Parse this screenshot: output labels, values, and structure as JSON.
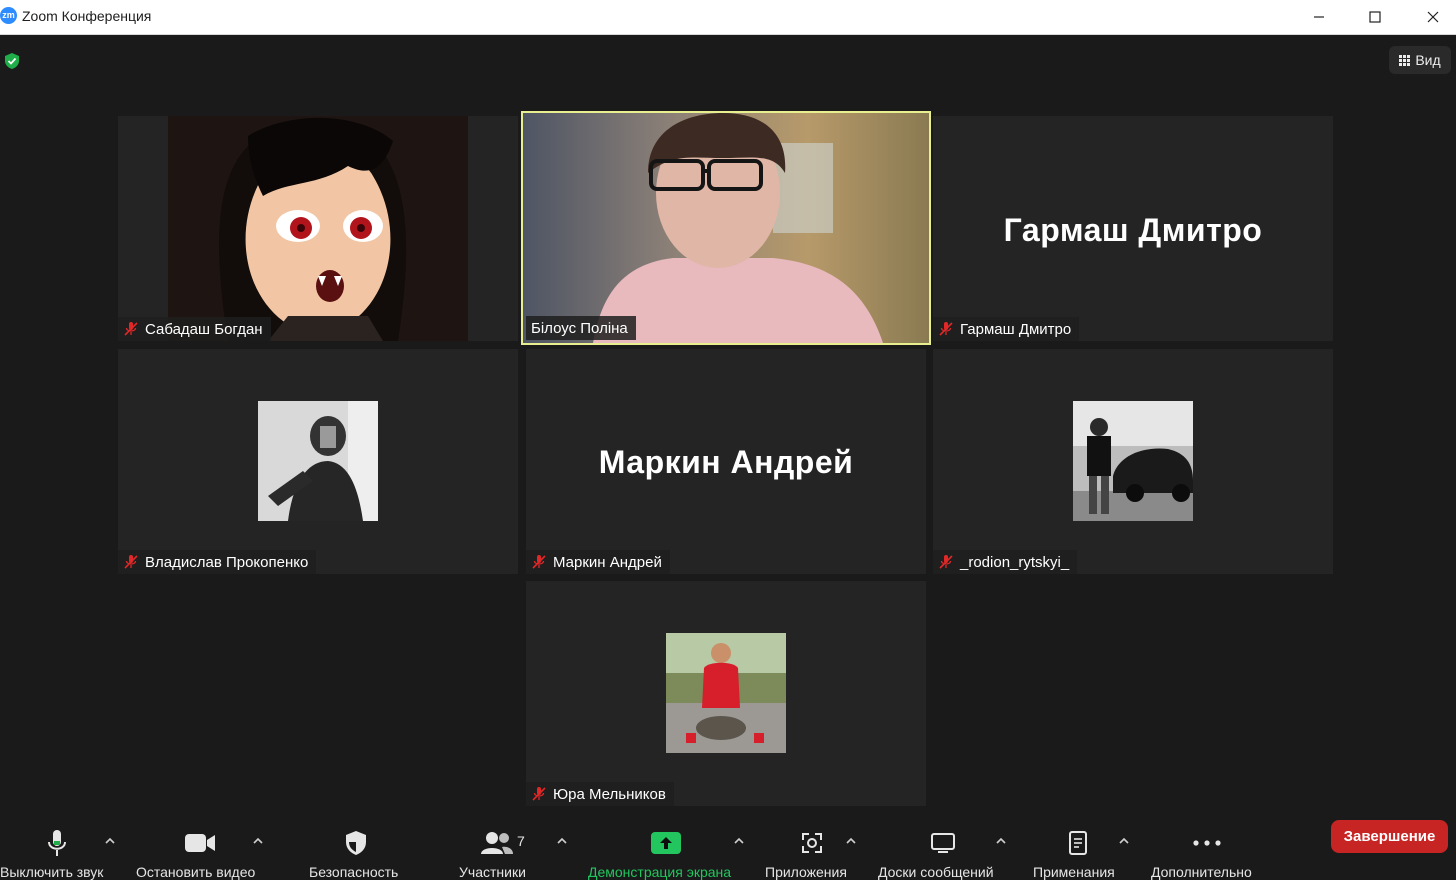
{
  "window": {
    "title": "Zoom Конференция",
    "app_icon_text": "zm",
    "controls": [
      "minimize-icon",
      "maximize-icon",
      "close-icon"
    ]
  },
  "top": {
    "security_badge_icon": "shield-check-icon",
    "view_label": "Вид",
    "view_icon": "grid-icon"
  },
  "tiles": [
    {
      "name": "Сабадаш Богдан",
      "muted": true,
      "video": "anime-picture",
      "active": false
    },
    {
      "name": "Білоус Поліна",
      "muted": false,
      "video": "camera",
      "active": true
    },
    {
      "name": "Гармаш Дмитро",
      "muted": true,
      "big_name": "Гармаш Дмитро",
      "active": false
    },
    {
      "name": "Владислав Прокопенко",
      "muted": true,
      "video": "avatar-photo",
      "active": false
    },
    {
      "name": "Маркин Андрей",
      "muted": true,
      "big_name": "Маркин Андрей",
      "active": false
    },
    {
      "name": "_rodion_rytskyi_",
      "muted": true,
      "video": "avatar-photo",
      "active": false
    },
    {
      "name": "Юра Мельников",
      "muted": true,
      "video": "avatar-photo",
      "active": false
    }
  ],
  "toolbar": {
    "mute_label": "Выключить звук",
    "video_label": "Остановить видео",
    "security_label": "Безопасность",
    "participants_label": "Участники",
    "participants_count": "7",
    "share_label": "Демонстрация экрана",
    "apps_label": "Приложения",
    "whiteboards_label": "Доски сообщений",
    "notes_label": "Применания",
    "more_label": "Дополнительно",
    "end_label": "Завершение"
  },
  "colors": {
    "active_speaker": "#e8ef8e",
    "share_green": "#22c55e",
    "end_red": "#c72424",
    "muted_red": "#e02828"
  }
}
